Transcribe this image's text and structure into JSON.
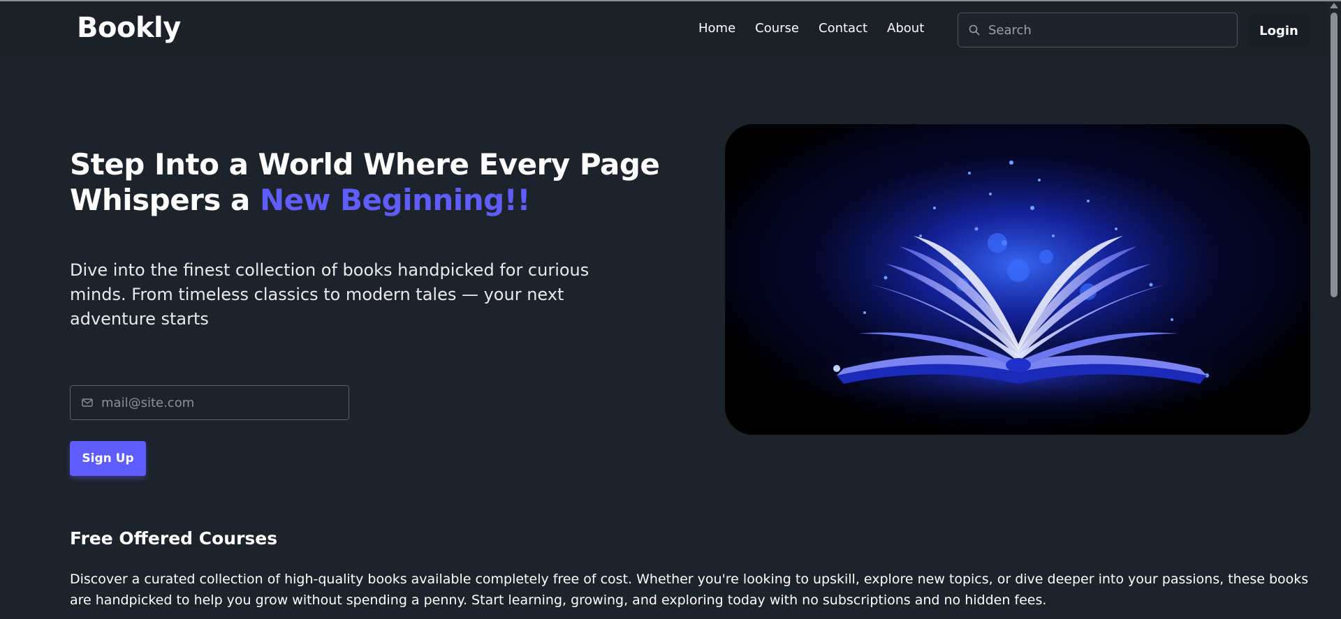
{
  "nav": {
    "brand": "Bookly",
    "links": [
      "Home",
      "Course",
      "Contact",
      "About"
    ],
    "search_placeholder": "Search",
    "login_label": "Login"
  },
  "hero": {
    "title_main": "Step Into a World Where Every Page Whispers a ",
    "title_accent": "New Beginning!!",
    "description": "Dive into the finest collection of books handpicked for curious minds. From timeless classics to modern tales — your next adventure starts",
    "email_placeholder": "mail@site.com",
    "signup_label": "Sign Up",
    "image_icon": "glowing-open-book-image"
  },
  "courses": {
    "title": "Free Offered Courses",
    "description": "Discover a curated collection of high-quality books available completely free of cost. Whether you're looking to upskill, explore new topics, or dive deeper into your passions, these books are handpicked to help you grow without spending a penny. Start learning, growing, and exploring today with no subscriptions and no hidden fees."
  },
  "colors": {
    "background": "#1d232a",
    "accent": "#605dff",
    "navbar": "#1c2128"
  }
}
